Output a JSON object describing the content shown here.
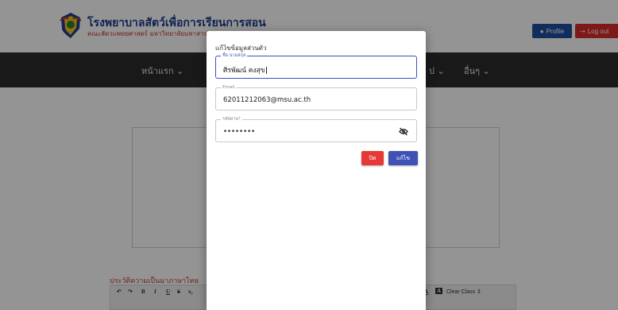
{
  "header": {
    "site_title": "โรงพยาบาลสัตว์เพื่อการเรียนการสอน",
    "site_subtitle": "คณะสัตวแพทยศาสตร์ มหาวิทยาลัยมหาสารคาม",
    "profile_label": "Profile",
    "logout_label": "Log out"
  },
  "navbar": {
    "items": [
      "หน้าแรก ⌄",
      "ป ⌄",
      "อื่นๆ ⌄"
    ]
  },
  "main": {
    "history_label": "ประวัติความเป็นมาภาษาไทย"
  },
  "editor_toolbar": {
    "row1": [
      "↶",
      "↷",
      "B",
      "I",
      "U",
      "S",
      "x₂"
    ],
    "clear_class": "Clear Class ⇕"
  },
  "modal": {
    "title": "แก้ไขข้อมูลส่วนตัว",
    "name_field": {
      "label": "ชื่อ นามสกุล",
      "value": "ศิรพัฒน์ คงสุข"
    },
    "email_field": {
      "label": "Email",
      "value": "62011212063@msu.ac.th"
    },
    "password_field": {
      "label": "รหัสผ่าน*",
      "value": "••••••••"
    },
    "close_label": "ปิด",
    "edit_label": "แก้ไข"
  },
  "colors": {
    "primary": "#3f51b5",
    "danger": "#e53935",
    "navbar": "#2b2b2b",
    "brand_blue": "#1e3d8f"
  }
}
